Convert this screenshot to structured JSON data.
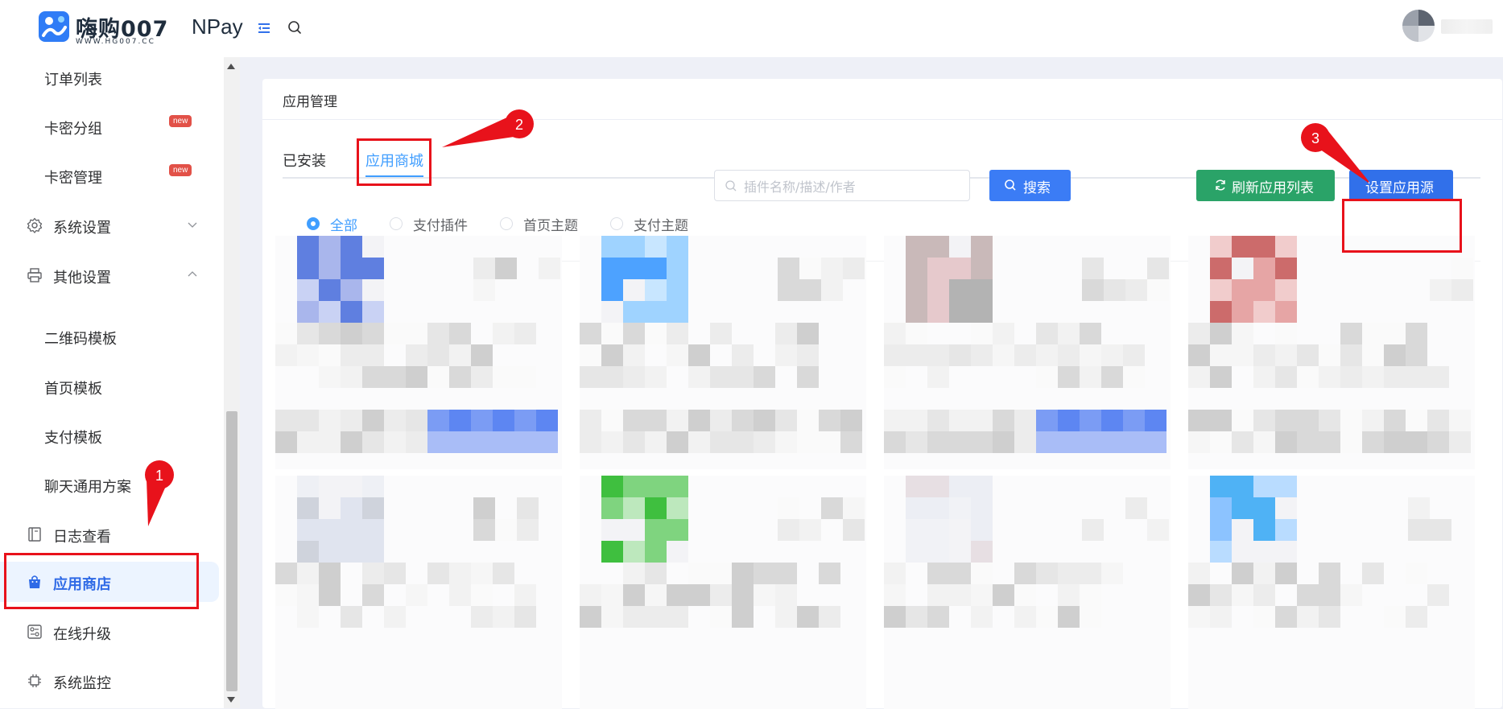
{
  "header": {
    "logo_title": "嗨购007",
    "logo_brand": "NPay",
    "logo_subtitle": "WWW.HG007.CC"
  },
  "sidebar": {
    "items": [
      {
        "label": "订单列表",
        "level": "sub"
      },
      {
        "label": "卡密分组",
        "level": "sub",
        "badge": "new"
      },
      {
        "label": "卡密管理",
        "level": "sub",
        "badge": "new"
      },
      {
        "label": "系统设置",
        "level": "top",
        "icon": "gear-icon",
        "expanded": false
      },
      {
        "label": "其他设置",
        "level": "top",
        "icon": "printer-icon",
        "expanded": true
      },
      {
        "label": "二维码模板",
        "level": "sub"
      },
      {
        "label": "首页模板",
        "level": "sub"
      },
      {
        "label": "支付模板",
        "level": "sub"
      },
      {
        "label": "聊天通用方案",
        "level": "sub"
      },
      {
        "label": "日志查看",
        "level": "top",
        "icon": "book-icon"
      },
      {
        "label": "应用商店",
        "level": "top",
        "icon": "shopping-bag-icon",
        "active": true
      },
      {
        "label": "在线升级",
        "level": "top",
        "icon": "upgrade-icon"
      },
      {
        "label": "系统监控",
        "level": "top",
        "icon": "chip-icon"
      }
    ]
  },
  "main": {
    "card_title": "应用管理",
    "tabs": [
      {
        "label": "已安装",
        "active": false
      },
      {
        "label": "应用商城",
        "active": true
      }
    ],
    "filters": [
      {
        "label": "全部",
        "checked": true
      },
      {
        "label": "支付插件",
        "checked": false
      },
      {
        "label": "首页主题",
        "checked": false
      },
      {
        "label": "支付主题",
        "checked": false
      }
    ],
    "search": {
      "placeholder": "插件名称/描述/作者",
      "value": ""
    },
    "buttons": {
      "search": "搜索",
      "refresh": "刷新应用列表",
      "set_source": "设置应用源"
    }
  },
  "annotations": [
    "1",
    "2",
    "3"
  ],
  "colors": {
    "primary": "#409eff",
    "button_blue": "#3b7cf5",
    "button_green": "#2aa368",
    "annotation_red": "#e8121b",
    "badge_red": "#e25148"
  }
}
